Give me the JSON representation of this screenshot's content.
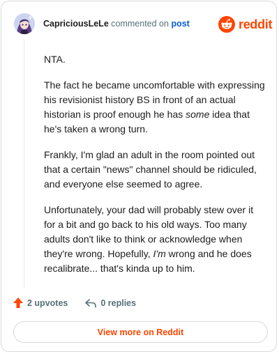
{
  "header": {
    "username": "CapriciousLeLe",
    "action_text": "commented on",
    "link_text": "post",
    "brand": "reddit",
    "brand_color": "#ff4500"
  },
  "comment": {
    "p1": "NTA.",
    "p2": "The fact he became uncomfortable with expressing his revisionist history BS in front of an actual historian is proof enough he has ",
    "p2_em": "some",
    "p2_end": " idea that he's taken a wrong turn.",
    "p3": "Frankly, I'm glad an adult in the room pointed out that a certain \"news\" channel should be ridiculed, and everyone else seemed to agree.",
    "p4": "Unfortunately, your dad will probably stew over it for a bit and go back to his old ways. Too many adults don't like to think or acknowledge when they're wrong. Hopefully, ",
    "p4_em": "I'm",
    "p4_end": " wrong and he does recalibrate... that's kinda up to him."
  },
  "actions": {
    "upvotes": "2 upvotes",
    "replies": "0 replies",
    "upvote_icon": "upvote-arrow-icon",
    "reply_icon": "reply-arrow-icon"
  },
  "footer": {
    "button_label": "View more on Reddit"
  }
}
